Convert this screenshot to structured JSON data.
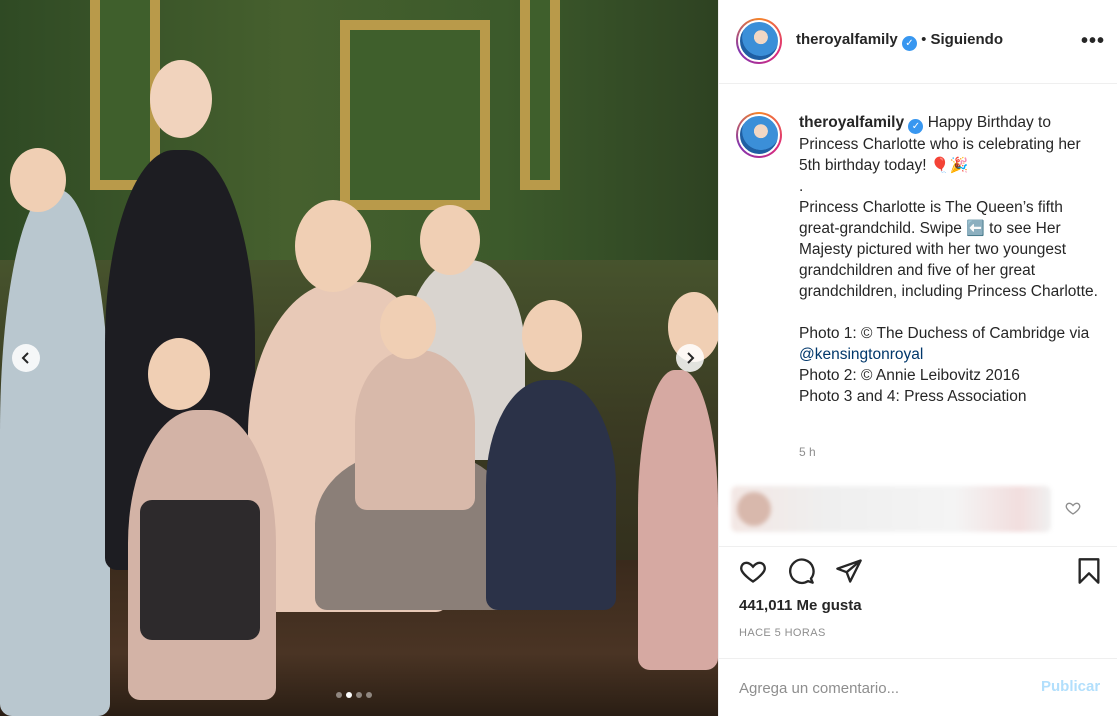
{
  "post": {
    "username": "theroyalfamily",
    "separator": "•",
    "follow_status": "Siguiendo",
    "more_label": "•••"
  },
  "caption": {
    "username": "theroyalfamily",
    "line1": "Happy Birthday to Princess Charlotte who is celebrating her 5th birthday today!",
    "line1_emoji": "🎈🎉",
    "dot": ".",
    "line2_pre": "Princess Charlotte is The Queen’s fifth great-grandchild. Swipe",
    "line2_emoji": "⬅️",
    "line2_post": "to see Her Majesty pictured with her two youngest grandchildren and five of her great grandchildren, including Princess Charlotte.",
    "credit1_pre": "Photo 1: © The Duchess of Cambridge via",
    "credit1_mention": "@kensingtonroyal",
    "credit2": "Photo 2: © Annie Leibovitz 2016",
    "credit3": "Photo 3 and 4: Press Association",
    "time": "5 h"
  },
  "actions": {
    "likes": "441,011 Me gusta",
    "ago": "HACE 5 HORAS"
  },
  "comment": {
    "placeholder": "Agrega un comentario...",
    "post_label": "Publicar"
  },
  "carousel": {
    "slide_count": 4,
    "active_index": 1
  },
  "icons": {
    "verified": "verified-badge-icon",
    "like": "heart-icon",
    "comment": "comment-bubble-icon",
    "share": "paper-plane-icon",
    "save": "bookmark-icon",
    "prev": "chevron-left-icon",
    "next": "chevron-right-icon"
  },
  "colors": {
    "verified_blue": "#3897f0",
    "mention_blue": "#00376b",
    "post_button_disabled": "#b2dffc",
    "muted_text": "#8e8e8e"
  }
}
